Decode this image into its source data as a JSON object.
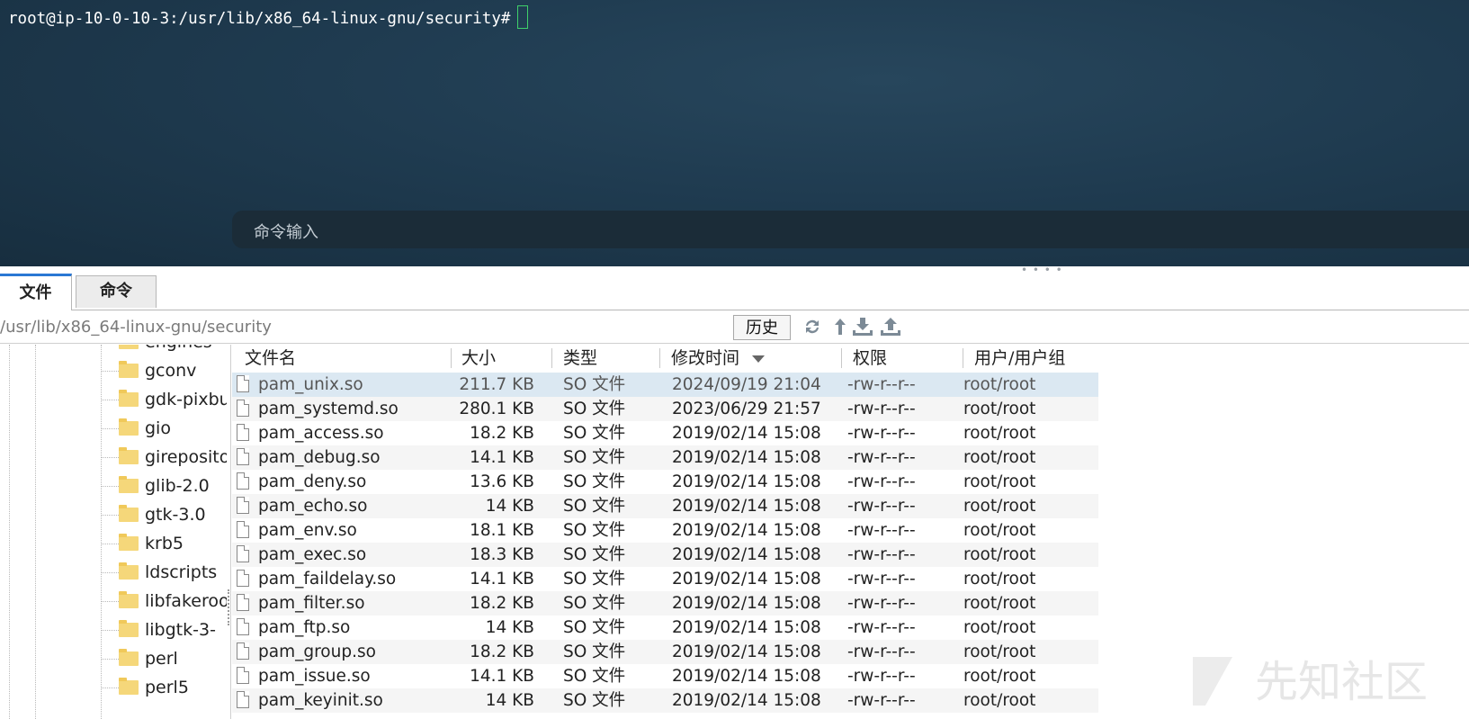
{
  "terminal": {
    "prompt": "root@ip-10-0-10-3:/usr/lib/x86_64-linux-gnu/security#",
    "command_input_placeholder": "命令输入"
  },
  "tabs": [
    {
      "label": "文件",
      "active": true
    },
    {
      "label": "命令",
      "active": false
    }
  ],
  "pathbar": {
    "path": "/usr/lib/x86_64-linux-gnu/security",
    "history_label": "历史",
    "tool_icons": [
      "refresh-icon",
      "up-arrow-icon",
      "download-icon",
      "upload-icon"
    ]
  },
  "tree": {
    "items": [
      "engines",
      "gconv",
      "gdk-pixbuf",
      "gio",
      "girepository",
      "glib-2.0",
      "gtk-3.0",
      "krb5",
      "ldscripts",
      "libfakeroot",
      "libgtk-3-",
      "perl",
      "perl5"
    ]
  },
  "filelist": {
    "columns": [
      "文件名",
      "大小",
      "类型",
      "修改时间",
      "权限",
      "用户/用户组"
    ],
    "rows": [
      {
        "name": "pam_unix.so",
        "size": "211.7 KB",
        "type": "SO 文件",
        "mtime": "2024/09/19 21:04",
        "perm": "-rw-r--r--",
        "owner": "root/root"
      },
      {
        "name": "pam_systemd.so",
        "size": "280.1 KB",
        "type": "SO 文件",
        "mtime": "2023/06/29 21:57",
        "perm": "-rw-r--r--",
        "owner": "root/root"
      },
      {
        "name": "pam_access.so",
        "size": "18.2 KB",
        "type": "SO 文件",
        "mtime": "2019/02/14 15:08",
        "perm": "-rw-r--r--",
        "owner": "root/root"
      },
      {
        "name": "pam_debug.so",
        "size": "14.1 KB",
        "type": "SO 文件",
        "mtime": "2019/02/14 15:08",
        "perm": "-rw-r--r--",
        "owner": "root/root"
      },
      {
        "name": "pam_deny.so",
        "size": "13.6 KB",
        "type": "SO 文件",
        "mtime": "2019/02/14 15:08",
        "perm": "-rw-r--r--",
        "owner": "root/root"
      },
      {
        "name": "pam_echo.so",
        "size": "14 KB",
        "type": "SO 文件",
        "mtime": "2019/02/14 15:08",
        "perm": "-rw-r--r--",
        "owner": "root/root"
      },
      {
        "name": "pam_env.so",
        "size": "18.1 KB",
        "type": "SO 文件",
        "mtime": "2019/02/14 15:08",
        "perm": "-rw-r--r--",
        "owner": "root/root"
      },
      {
        "name": "pam_exec.so",
        "size": "18.3 KB",
        "type": "SO 文件",
        "mtime": "2019/02/14 15:08",
        "perm": "-rw-r--r--",
        "owner": "root/root"
      },
      {
        "name": "pam_faildelay.so",
        "size": "14.1 KB",
        "type": "SO 文件",
        "mtime": "2019/02/14 15:08",
        "perm": "-rw-r--r--",
        "owner": "root/root"
      },
      {
        "name": "pam_filter.so",
        "size": "18.2 KB",
        "type": "SO 文件",
        "mtime": "2019/02/14 15:08",
        "perm": "-rw-r--r--",
        "owner": "root/root"
      },
      {
        "name": "pam_ftp.so",
        "size": "14 KB",
        "type": "SO 文件",
        "mtime": "2019/02/14 15:08",
        "perm": "-rw-r--r--",
        "owner": "root/root"
      },
      {
        "name": "pam_group.so",
        "size": "18.2 KB",
        "type": "SO 文件",
        "mtime": "2019/02/14 15:08",
        "perm": "-rw-r--r--",
        "owner": "root/root"
      },
      {
        "name": "pam_issue.so",
        "size": "14.1 KB",
        "type": "SO 文件",
        "mtime": "2019/02/14 15:08",
        "perm": "-rw-r--r--",
        "owner": "root/root"
      },
      {
        "name": "pam_keyinit.so",
        "size": "14 KB",
        "type": "SO 文件",
        "mtime": "2019/02/14 15:08",
        "perm": "-rw-r--r--",
        "owner": "root/root"
      }
    ]
  },
  "watermark": "先知社区",
  "colors": {
    "accent": "#2a78d4",
    "selected_row": "#dbe8f2",
    "terminal_bg": "#1f3b50",
    "cursor": "#3fd06a"
  }
}
